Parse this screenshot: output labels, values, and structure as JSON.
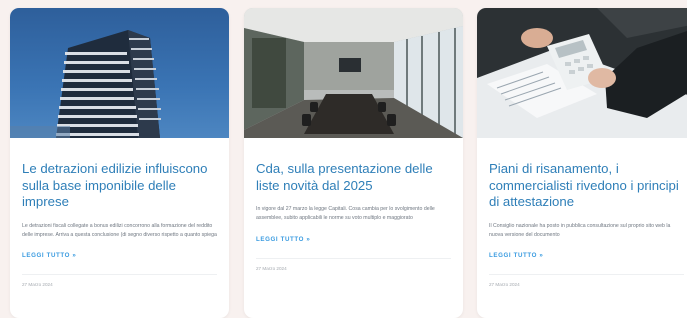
{
  "cards": [
    {
      "title": "Le detrazioni edilizie influiscono sulla base imponibile delle imprese",
      "excerpt": "Le detrazioni fiscali collegate a bonus edilizi concorrono alla formazione del reddito delle imprese. Arriva a questa conclusione (di segno diverso rispetto a quanto spiega",
      "more_label": "LEGGI TUTTO »",
      "date": "27 Marzo 2024",
      "image_icon": "building-photo"
    },
    {
      "title": "Cda, sulla presentazione delle liste novità dal 2025",
      "excerpt": "In vigore dal 27 marzo la legge Capitali. Cosa cambia per lo svolgimento delle assemblee, subito applicabili le norme su voto multiplo e maggiorato",
      "more_label": "LEGGI TUTTO »",
      "date": "27 Marzo 2024",
      "image_icon": "boardroom-photo"
    },
    {
      "title": "Piani di risanamento, i commercialisti rivedono i principi di attestazione",
      "excerpt": "Il Consiglio nazionale ha posto in pubblica consultazione sul proprio sito web la nuova versione del documento",
      "more_label": "LEGGI TUTTO »",
      "date": "27 Marzo 2024",
      "image_icon": "calculator-documents-photo"
    }
  ],
  "colors": {
    "page_background": "#f8f1ef",
    "title": "#2f7fb8",
    "link": "#3a9be0",
    "text": "#6f7781"
  }
}
